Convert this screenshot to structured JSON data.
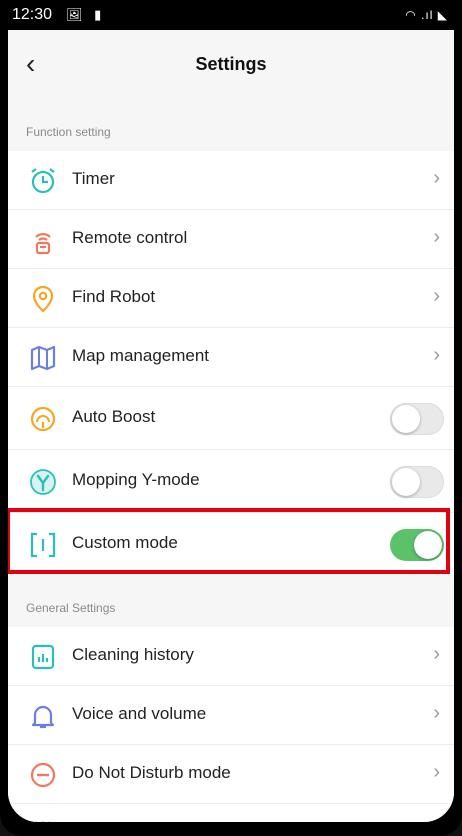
{
  "status": {
    "time": "12:30"
  },
  "header": {
    "title": "Settings"
  },
  "sections": {
    "function": {
      "label": "Function setting",
      "items": [
        {
          "label": "Timer",
          "icon": "alarm-clock-icon",
          "control": "chevron"
        },
        {
          "label": "Remote control",
          "icon": "remote-icon",
          "control": "chevron"
        },
        {
          "label": "Find Robot",
          "icon": "location-pin-icon",
          "control": "chevron"
        },
        {
          "label": "Map management",
          "icon": "map-icon",
          "control": "chevron"
        },
        {
          "label": "Auto Boost",
          "icon": "gauge-icon",
          "control": "toggle",
          "on": false
        },
        {
          "label": "Mopping Y-mode",
          "icon": "y-mode-icon",
          "control": "toggle",
          "on": false
        },
        {
          "label": "Custom mode",
          "icon": "custom-mode-icon",
          "control": "toggle",
          "on": true
        }
      ]
    },
    "general": {
      "label": "General Settings",
      "items": [
        {
          "label": "Cleaning history",
          "icon": "history-chart-icon",
          "control": "chevron"
        },
        {
          "label": "Voice and volume",
          "icon": "bell-icon",
          "control": "chevron"
        },
        {
          "label": "Do Not Disturb mode",
          "icon": "dnd-icon",
          "control": "chevron"
        }
      ]
    }
  },
  "colors": {
    "toggle_on": "#5bc26a",
    "highlight": "#e3000f"
  }
}
